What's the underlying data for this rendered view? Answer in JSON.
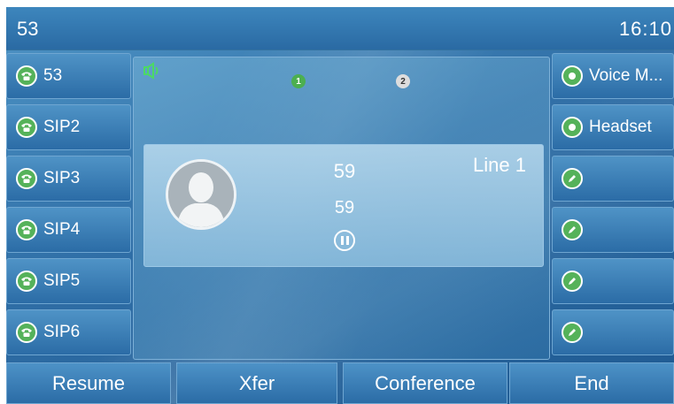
{
  "status_bar": {
    "account": "53",
    "time": "16:10"
  },
  "line_keys_left": [
    {
      "label": "53",
      "icon": "phone-icon"
    },
    {
      "label": "SIP2",
      "icon": "phone-icon"
    },
    {
      "label": "SIP3",
      "icon": "phone-icon"
    },
    {
      "label": "SIP4",
      "icon": "phone-icon"
    },
    {
      "label": "SIP5",
      "icon": "phone-icon"
    },
    {
      "label": "SIP6",
      "icon": "phone-icon"
    }
  ],
  "line_keys_right": [
    {
      "label": "Voice M...",
      "icon": "status-dot-icon"
    },
    {
      "label": "Headset",
      "icon": "status-dot-icon"
    },
    {
      "label": "",
      "icon": "edit-icon"
    },
    {
      "label": "",
      "icon": "edit-icon"
    },
    {
      "label": "",
      "icon": "edit-icon"
    },
    {
      "label": "",
      "icon": "edit-icon"
    }
  ],
  "call_indicators": {
    "first": "1",
    "second": "2"
  },
  "call": {
    "name": "59",
    "number": "59",
    "line": "Line 1",
    "state_icon": "hold-icon"
  },
  "softkeys": [
    "Resume",
    "Xfer",
    "Conference",
    "End"
  ],
  "colors": {
    "accent_green": "#55b25a",
    "screen_blue": "#2f6ea6"
  }
}
